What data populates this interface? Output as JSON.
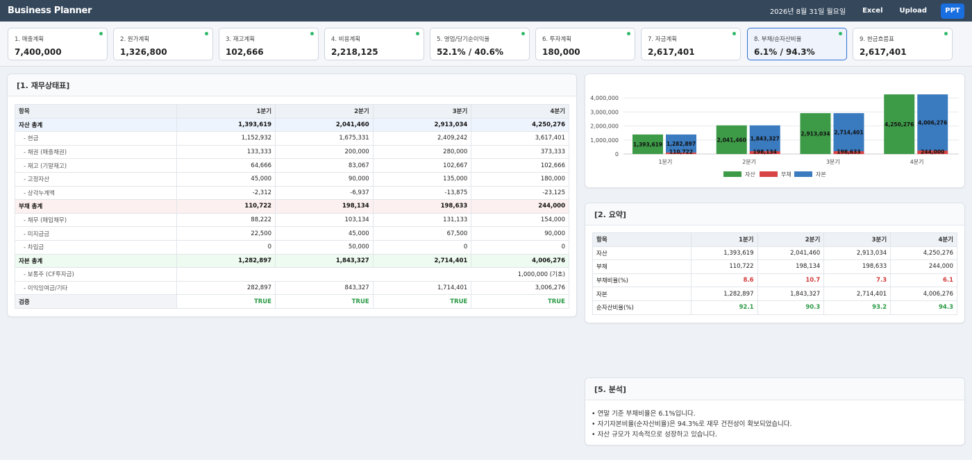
{
  "app": {
    "title": "Business Planner",
    "date": "2026년 8월 31일 월요일",
    "btn_excel": "Excel",
    "btn_upload": "Upload",
    "btn_ppt": "PPT"
  },
  "cards": [
    {
      "label": "1. 매출계획",
      "value": "7,400,000"
    },
    {
      "label": "2. 원가계획",
      "value": "1,326,800"
    },
    {
      "label": "3. 재고계획",
      "value": "102,666"
    },
    {
      "label": "4. 비용계획",
      "value": "2,218,125"
    },
    {
      "label": "5. 영업/당기순이익율",
      "value": "52.1% / 40.6%"
    },
    {
      "label": "6. 투자계획",
      "value": "180,000"
    },
    {
      "label": "7. 자금계획",
      "value": "2,617,401"
    },
    {
      "label": "8. 부채/순자산비율",
      "value": "6.1% / 94.3%"
    },
    {
      "label": "9. 현금흐름표",
      "value": "2,617,401"
    }
  ],
  "balance": {
    "title": "[1. 재무상태표]",
    "headers": [
      "항목",
      "1분기",
      "2분기",
      "3분기",
      "4분기"
    ],
    "rows": [
      {
        "label": "자산 총계",
        "values": [
          "1,393,619",
          "2,041,460",
          "2,913,034",
          "4,250,276"
        ]
      },
      {
        "label": "- 현금",
        "values": [
          "1,152,932",
          "1,675,331",
          "2,409,242",
          "3,617,401"
        ]
      },
      {
        "label": "- 채권 (매출채권)",
        "values": [
          "133,333",
          "200,000",
          "280,000",
          "373,333"
        ]
      },
      {
        "label": "- 재고 (기말재고)",
        "values": [
          "64,666",
          "83,067",
          "102,667",
          "102,666"
        ]
      },
      {
        "label": "- 고정자산",
        "values": [
          "45,000",
          "90,000",
          "135,000",
          "180,000"
        ]
      },
      {
        "label": "- 상각누계액",
        "values": [
          "-2,312",
          "-6,937",
          "-13,875",
          "-23,125"
        ]
      },
      {
        "label": "부채 총계",
        "values": [
          "110,722",
          "198,134",
          "198,633",
          "244,000"
        ]
      },
      {
        "label": "- 채무 (매입채무)",
        "values": [
          "88,222",
          "103,134",
          "131,133",
          "154,000"
        ]
      },
      {
        "label": "- 미지급금",
        "values": [
          "22,500",
          "45,000",
          "67,500",
          "90,000"
        ]
      },
      {
        "label": "- 차입금",
        "values": [
          "0",
          "50,000",
          "0",
          "0"
        ]
      },
      {
        "label": "자본 총계",
        "values": [
          "1,282,897",
          "1,843,327",
          "2,714,401",
          "4,006,276"
        ]
      },
      {
        "label": "- 보통주 (CF투자금)",
        "value": "1,000,000 (기초)"
      },
      {
        "label": "- 이익잉여금/기타",
        "values": [
          "282,897",
          "843,327",
          "1,714,401",
          "3,006,276"
        ]
      },
      {
        "label": "검증",
        "values": [
          "TRUE",
          "TRUE",
          "TRUE",
          "TRUE"
        ]
      }
    ]
  },
  "summary": {
    "title": "[2. 요약]",
    "headers": [
      "항목",
      "1분기",
      "2분기",
      "3분기",
      "4분기"
    ],
    "rows": [
      {
        "label": "자산",
        "values": [
          "1,393,619",
          "2,041,460",
          "2,913,034",
          "4,250,276"
        ]
      },
      {
        "label": "부채",
        "values": [
          "110,722",
          "198,134",
          "198,633",
          "244,000"
        ]
      },
      {
        "label": "부채비율(%)",
        "values": [
          "8.6",
          "10.7",
          "7.3",
          "6.1"
        ]
      },
      {
        "label": "자본",
        "values": [
          "1,282,897",
          "1,843,327",
          "2,714,401",
          "4,006,276"
        ]
      },
      {
        "label": "순자산비율(%)",
        "values": [
          "92.1",
          "90.3",
          "93.2",
          "94.3"
        ]
      }
    ]
  },
  "analysis": {
    "title": "[5. 분석]",
    "lines": [
      "• 연말 기준 부채비율은 6.1%입니다.",
      "• 자기자본비율(순자산비율)은 94.3%로 재무 건전성이 확보되었습니다.",
      "• 자산 규모가 지속적으로 성장하고 있습니다."
    ]
  },
  "chart_data": {
    "type": "bar",
    "categories": [
      "1분기",
      "2분기",
      "3분기",
      "4분기"
    ],
    "series": [
      {
        "name": "자산",
        "color": "#3d9a47",
        "values": [
          1393619,
          2041460,
          2913034,
          4250276
        ],
        "labels": [
          "1,393,619",
          "2,041,460",
          "2,913,034",
          "4,250,276"
        ]
      },
      {
        "name": "부채",
        "color": "#d84343",
        "values": [
          110722,
          198134,
          198633,
          244000
        ],
        "labels": [
          "110,722",
          "198,134",
          "198,633",
          "244,000"
        ]
      },
      {
        "name": "자본",
        "color": "#3a7abf",
        "values": [
          1282897,
          1843327,
          2714401,
          4006276
        ],
        "labels": [
          "1,282,897",
          "1,843,327",
          "2,714,401",
          "4,006,276"
        ]
      }
    ],
    "yticks": [
      "0",
      "1,000,000",
      "2,000,000",
      "3,000,000",
      "4,000,000"
    ],
    "ylim": [
      0,
      4400000
    ],
    "legend": "bottom",
    "grid": true
  }
}
